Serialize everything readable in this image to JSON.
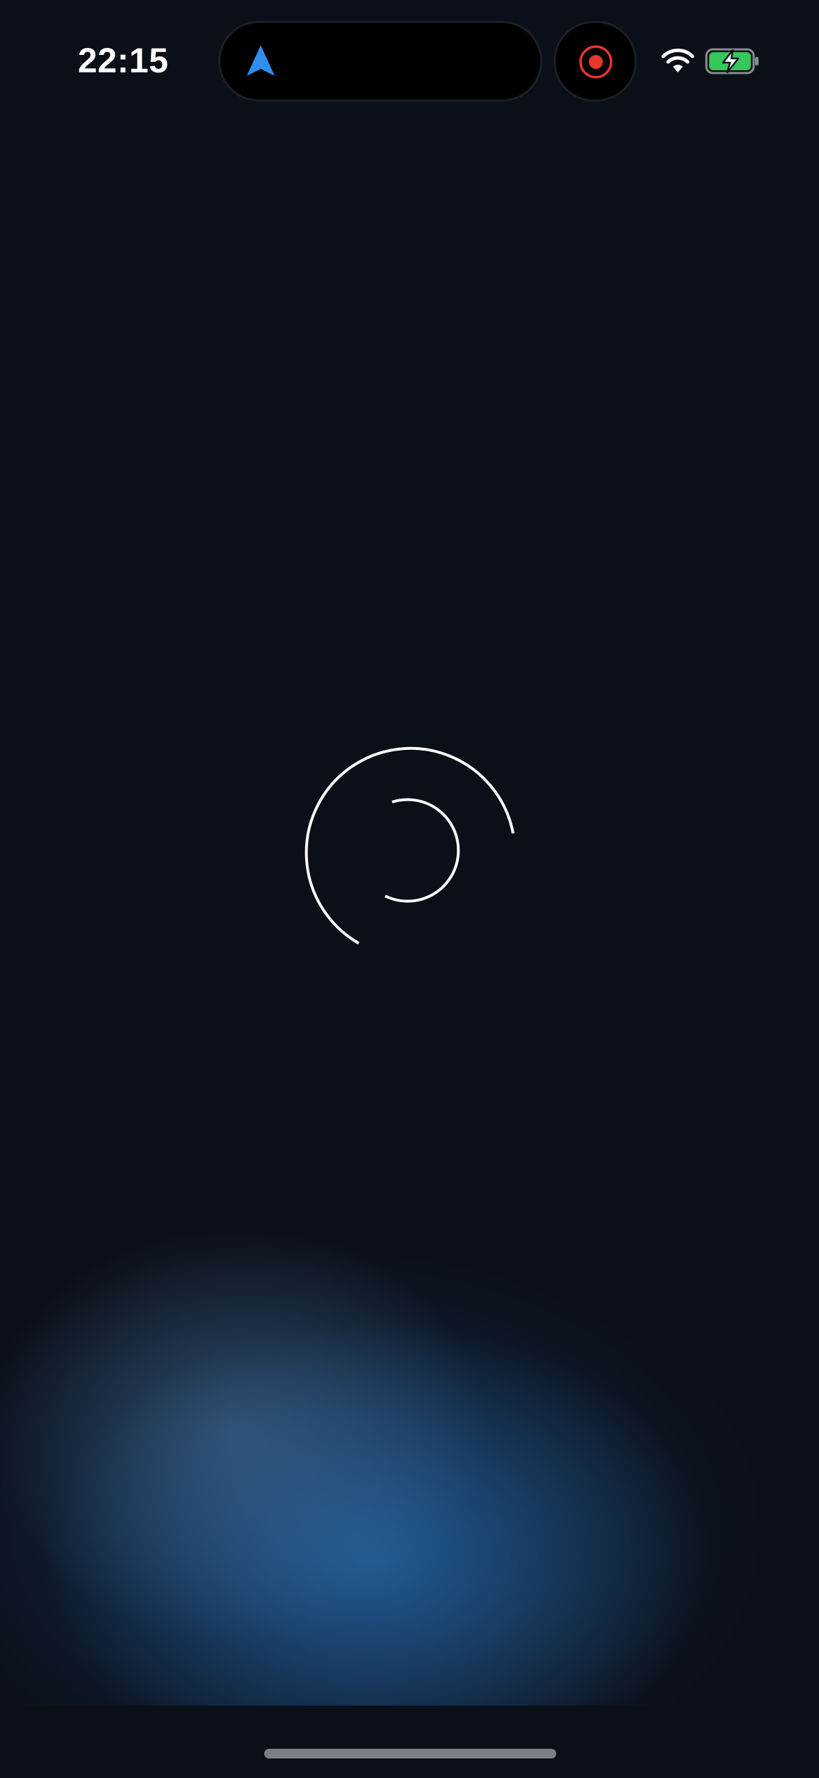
{
  "status_bar": {
    "time": "22:15",
    "navigation_icon": "location-arrow-icon",
    "recording_icon": "screen-recording-icon",
    "wifi_icon": "wifi-icon",
    "battery_icon": "battery-charging-icon",
    "battery_state": "charging"
  },
  "main": {
    "loading_icon": "loading-spinner-icon"
  },
  "colors": {
    "background": "#0b0f18",
    "accent_blue": "#2f8ff0",
    "recording_red": "#e8372d",
    "battery_green": "#34c759",
    "glow_blue": "#2669aa"
  }
}
